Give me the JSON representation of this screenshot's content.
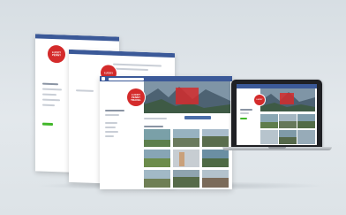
{
  "scene": {
    "background_color": "#dfe5e9",
    "brand_color": "#d42b2b",
    "facebook_blue": "#3b5998"
  },
  "badge": {
    "line1": "LUCKY",
    "line2": "PENNY",
    "line3": "TRAVEL"
  },
  "icons": [
    "facebook-logo-icon",
    "search-icon"
  ]
}
